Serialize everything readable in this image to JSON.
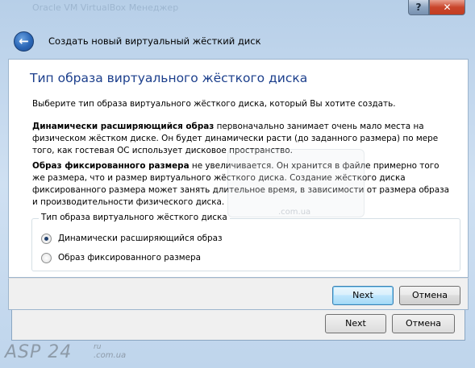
{
  "background": {
    "title": "Oracle VM VirtualBox Менеджер",
    "next_label": "Next",
    "cancel_label": "Отмена"
  },
  "titlebar": {
    "help_label": "?",
    "close_label": "✕"
  },
  "header": {
    "back_icon": "back-arrow-icon",
    "title": "Создать новый виртуальный жёсткий диск"
  },
  "page": {
    "title": "Тип образа виртуального жёсткого диска",
    "intro": "Выберите тип образа виртуального жёсткого диска, который Вы хотите создать.",
    "dynamic_bold": "Динамически расширяющийся образ",
    "dynamic_text": " первоначально занимает очень мало места на физическом жёстком диске. Он будет динамически расти (до заданного размера) по мере того, как гостевая ОС использует дисковое пространство.",
    "fixed_bold": "Образ фиксированного размера",
    "fixed_text": " не увеличивается. Он хранится в файле примерно того же размера, что и размер виртуального жёсткого диска. Создание жёсткого диска фиксированного размера может занять длительное время, в зависимости от размера образа и производительности физического диска."
  },
  "group": {
    "label": "Тип образа виртуального жёсткого диска",
    "options": [
      {
        "label": "Динамически расширяющийся образ",
        "selected": true
      },
      {
        "label": "Образ фиксированного размера",
        "selected": false
      }
    ]
  },
  "footer": {
    "next_label": "Next",
    "cancel_label": "Отмена"
  },
  "watermark": {
    "logo": "ASP 24",
    "sup": "ru",
    "domain": ".com.ua",
    "center_text": ".com.ua"
  },
  "colors": {
    "accent": "#1c3f8c",
    "close_red": "#c9462c",
    "next_border": "#3c7fb1"
  }
}
